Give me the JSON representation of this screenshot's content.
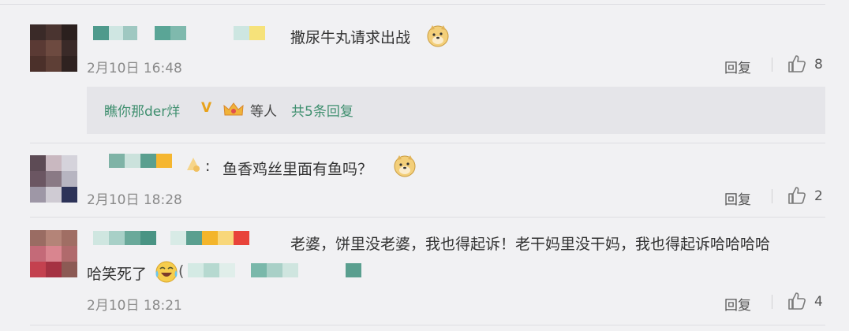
{
  "colors": {
    "accent_green": "#3f8f6f",
    "timestamp_gray": "#8a8a8a",
    "background": "#f1f1f3"
  },
  "comments": [
    {
      "text": "撒尿牛丸请求出战",
      "timestamp": "2月10日 16:48",
      "reply_label": "回复",
      "like_count": "8",
      "emoji": "doge-emoji",
      "replies": {
        "user": "瞧你那der烊",
        "badge": "V",
        "badge_icon": "crown-icon",
        "others": "等人",
        "count_link": "共5条回复"
      }
    },
    {
      "text": "鱼香鸡丝里面有鱼吗？",
      "prefix": ":",
      "timestamp": "2月10日 18:28",
      "reply_label": "回复",
      "like_count": "2",
      "emoji": "doge-emoji"
    },
    {
      "text_line1": "老婆，饼里没老婆，我也得起诉！老干妈里没干妈，我也得起诉哈哈哈哈",
      "text_line2": "哈笑死了",
      "timestamp": "2月10日 18:21",
      "reply_label": "回复",
      "like_count": "4",
      "emoji": "laugh-cry-emoji"
    }
  ]
}
